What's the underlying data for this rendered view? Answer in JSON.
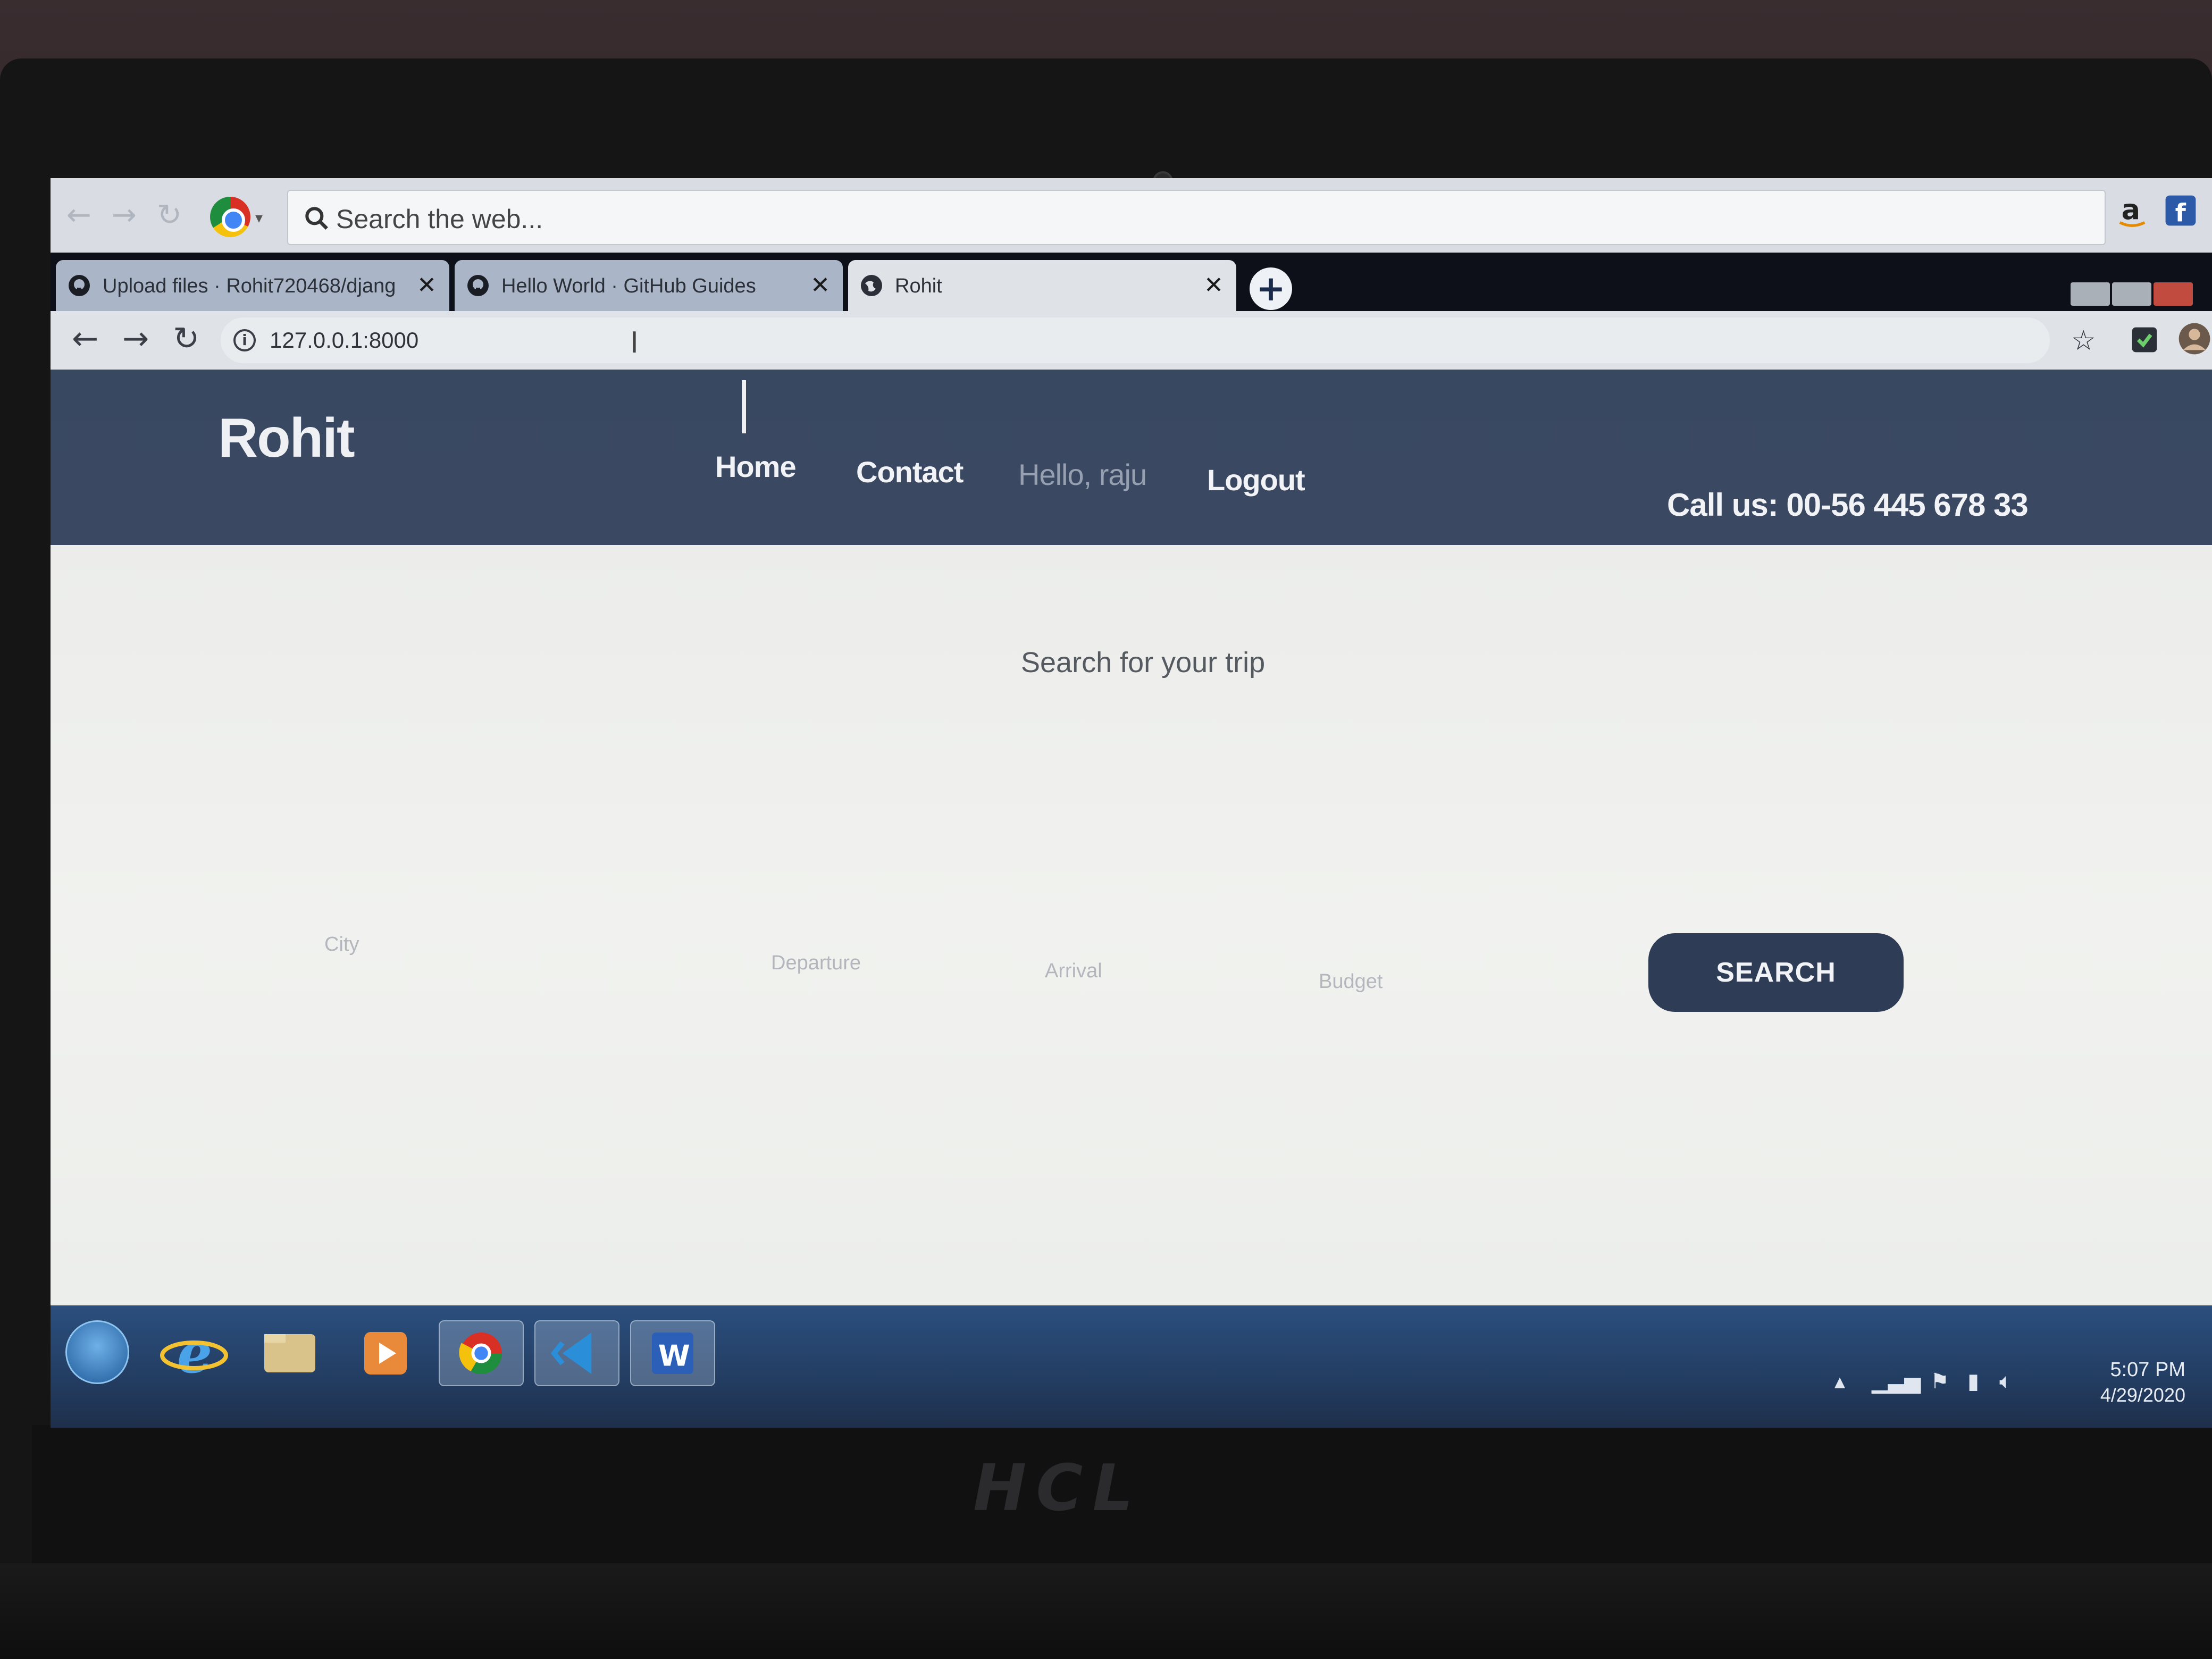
{
  "browser": {
    "search_placeholder": "Search the web...",
    "tabs": [
      {
        "title": "Upload files · Rohit720468/djang",
        "close": "✕"
      },
      {
        "title": "Hello World · GitHub Guides",
        "close": "✕"
      },
      {
        "title": "Rohit",
        "close": "✕"
      }
    ],
    "new_tab": "+",
    "url": "127.0.0.1:8000"
  },
  "site": {
    "brand": "Rohit",
    "nav": {
      "home": "Home",
      "contact": "Contact",
      "greeting": "Hello, raju",
      "logout": "Logout"
    },
    "call_us": "Call us: 00-56 445 678 33"
  },
  "search": {
    "heading": "Search for your trip",
    "city_placeholder": "City",
    "departure_placeholder": "Departure",
    "arrival_placeholder": "Arrival",
    "budget_placeholder": "Budget",
    "button": "SEARCH"
  },
  "taskbar": {
    "time": "5:07 PM",
    "date": "4/29/2020"
  },
  "device": {
    "logo": "HCL"
  },
  "colors": {
    "header": "#394861",
    "button": "#2f3c55",
    "page_bg": "#eeefec"
  }
}
